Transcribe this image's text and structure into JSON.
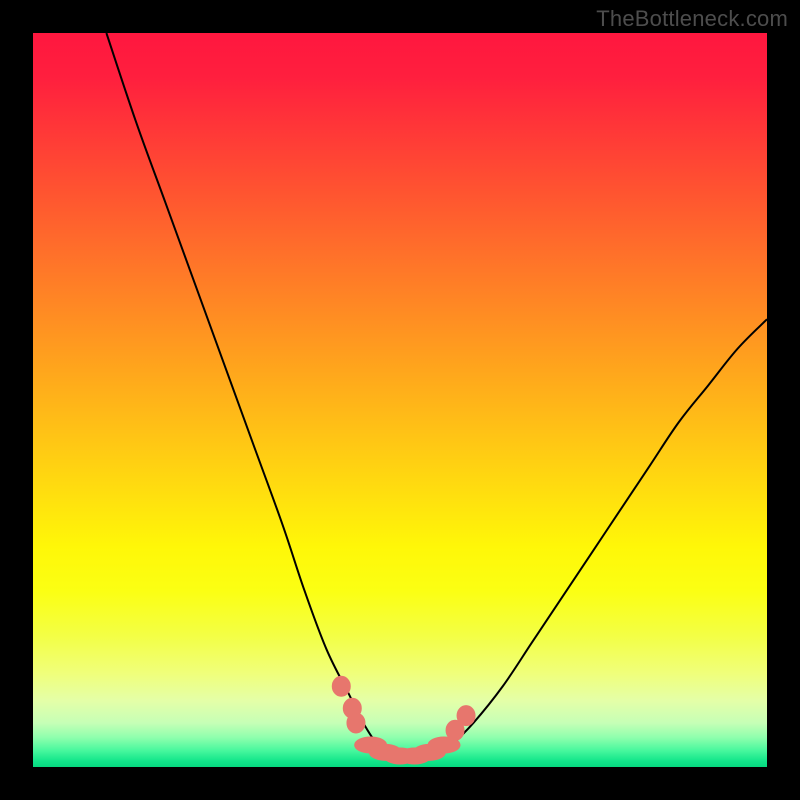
{
  "watermark": "TheBottleneck.com",
  "colors": {
    "frame": "#000000",
    "curve_stroke": "#000000",
    "marker_fill": "#e7766d",
    "marker_stroke": "#e7766d",
    "gradient_stops": [
      {
        "offset": 0.0,
        "color": "#ff173f"
      },
      {
        "offset": 0.06,
        "color": "#ff1f3e"
      },
      {
        "offset": 0.14,
        "color": "#ff3a37"
      },
      {
        "offset": 0.22,
        "color": "#ff5530"
      },
      {
        "offset": 0.3,
        "color": "#ff702a"
      },
      {
        "offset": 0.38,
        "color": "#ff8b23"
      },
      {
        "offset": 0.46,
        "color": "#ffa61c"
      },
      {
        "offset": 0.54,
        "color": "#ffc116"
      },
      {
        "offset": 0.62,
        "color": "#ffdc0f"
      },
      {
        "offset": 0.7,
        "color": "#fff708"
      },
      {
        "offset": 0.76,
        "color": "#fbff13"
      },
      {
        "offset": 0.82,
        "color": "#f3ff44"
      },
      {
        "offset": 0.872,
        "color": "#f0ff7a"
      },
      {
        "offset": 0.91,
        "color": "#e4ffa8"
      },
      {
        "offset": 0.94,
        "color": "#c6ffb6"
      },
      {
        "offset": 0.96,
        "color": "#8effad"
      },
      {
        "offset": 0.978,
        "color": "#46f79d"
      },
      {
        "offset": 0.992,
        "color": "#12e58a"
      },
      {
        "offset": 1.0,
        "color": "#06d97f"
      }
    ]
  },
  "chart_data": {
    "type": "line",
    "title": "",
    "xlabel": "",
    "ylabel": "",
    "xlim": [
      0,
      100
    ],
    "ylim": [
      0,
      100
    ],
    "grid": false,
    "series": [
      {
        "name": "bottleneck-curve",
        "x": [
          10,
          14,
          18,
          22,
          26,
          30,
          34,
          37,
          40,
          43,
          45,
          47,
          49,
          51,
          53,
          55,
          57,
          60,
          64,
          68,
          72,
          76,
          80,
          84,
          88,
          92,
          96,
          100
        ],
        "y": [
          100,
          88,
          77,
          66,
          55,
          44,
          33,
          24,
          16,
          10,
          6,
          3,
          1.5,
          1,
          1,
          1.5,
          3,
          6,
          11,
          17,
          23,
          29,
          35,
          41,
          47,
          52,
          57,
          61
        ]
      }
    ],
    "markers": [
      {
        "x": 42,
        "y": 11
      },
      {
        "x": 43.5,
        "y": 8
      },
      {
        "x": 44,
        "y": 6
      },
      {
        "x": 46,
        "y": 3
      },
      {
        "x": 48,
        "y": 2
      },
      {
        "x": 50,
        "y": 1.5
      },
      {
        "x": 52,
        "y": 1.5
      },
      {
        "x": 54,
        "y": 2
      },
      {
        "x": 56,
        "y": 3
      },
      {
        "x": 57.5,
        "y": 5
      },
      {
        "x": 59,
        "y": 7
      }
    ]
  }
}
